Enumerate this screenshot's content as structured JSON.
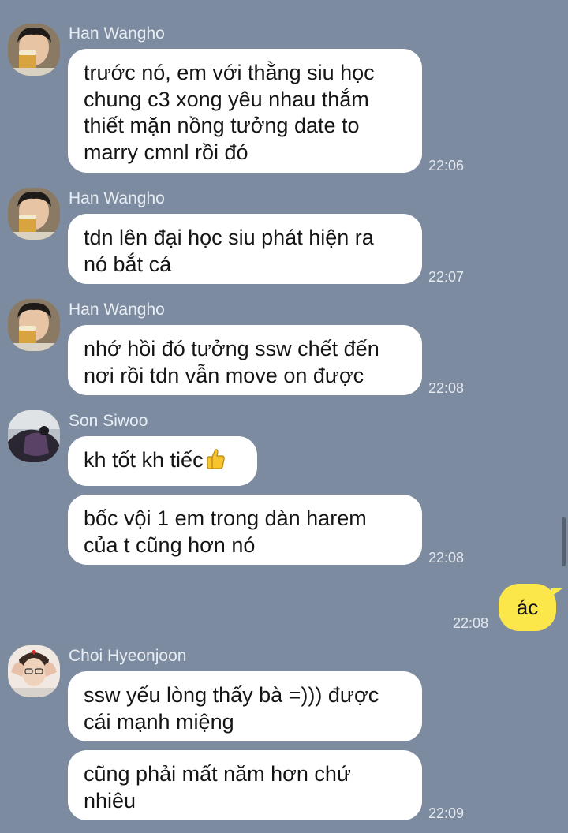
{
  "messages": [
    {
      "sender": "Han Wangho",
      "lines": [
        "trước nó, em với thằng siu học",
        "chung c3 xong yêu nhau thắm",
        "thiết mặn nồng tưởng date to",
        "marry cmnl rồi đó"
      ],
      "time": "22:06"
    },
    {
      "sender": "Han Wangho",
      "lines": [
        "tdn lên đại học siu phát hiện ra",
        "nó bắt cá"
      ],
      "time": "22:07"
    },
    {
      "sender": "Han Wangho",
      "lines": [
        "nhớ hồi đó tưởng ssw chết đến",
        "nơi rồi tdn vẫn move on được"
      ],
      "time": "22:08"
    },
    {
      "sender": "Son Siwoo",
      "lines": [
        "kh tốt kh tiếc"
      ],
      "emoji": "thumbs-up",
      "followup_lines": [
        "bốc vội 1 em trong dàn harem",
        "của t cũng hơn nó"
      ],
      "time": "22:08"
    },
    {
      "sender": "me",
      "text": "ác",
      "time": "22:08"
    },
    {
      "sender": "Choi Hyeonjoon",
      "lines": [
        "ssw yếu lòng thấy bà =))) được",
        "cái mạnh miệng"
      ],
      "followup_lines": [
        "cũng phải mất năm hơn chứ",
        "nhiêu"
      ],
      "time": "22:09"
    }
  ],
  "colors": {
    "background": "#7d8ba0",
    "incoming_bubble": "#ffffff",
    "outgoing_bubble": "#fbe74a"
  }
}
